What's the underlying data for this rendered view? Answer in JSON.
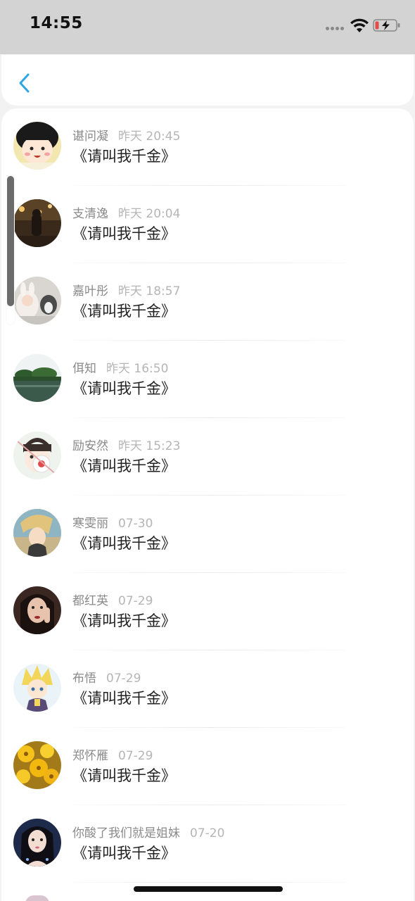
{
  "status_bar": {
    "time": "14:55",
    "icons": [
      "cellular-dots-icon",
      "wifi-icon",
      "battery-charging-icon"
    ]
  },
  "nav": {
    "back_icon": "chevron-left-icon",
    "accent_color": "#2ea6e6"
  },
  "colors": {
    "status_bar_bg": "#d3d3d3",
    "page_bg": "#f2f2f2",
    "card_bg": "#ffffff",
    "name_text": "#8a8a8a",
    "time_text": "#b5b5b5",
    "title_text": "#222222",
    "battery_low": "#e34a4a"
  },
  "list": {
    "items": [
      {
        "name": "谌问凝",
        "time": "昨天 20:45",
        "title": "《请叫我千金》",
        "avatar": "cartoon-girl-avatar"
      },
      {
        "name": "支清逸",
        "time": "昨天 20:04",
        "title": "《请叫我千金》",
        "avatar": "night-street-avatar"
      },
      {
        "name": "嘉叶彤",
        "time": "昨天 18:57",
        "title": "《请叫我千金》",
        "avatar": "baby-and-dog-avatar"
      },
      {
        "name": "佴知",
        "time": "昨天 16:50",
        "title": "《请叫我千金》",
        "avatar": "lake-landscape-avatar"
      },
      {
        "name": "励安然",
        "time": "昨天 15:23",
        "title": "《请叫我千金》",
        "avatar": "anime-boy-mask-avatar"
      },
      {
        "name": "寒雯丽",
        "time": "07-30",
        "title": "《请叫我千金》",
        "avatar": "anime-blonde-avatar"
      },
      {
        "name": "都红英",
        "time": "07-29",
        "title": "《请叫我千金》",
        "avatar": "woman-portrait-avatar"
      },
      {
        "name": "布悟",
        "time": "07-29",
        "title": "《请叫我千金》",
        "avatar": "anime-yellow-hair-avatar"
      },
      {
        "name": "郑怀雁",
        "time": "07-29",
        "title": "《请叫我千金》",
        "avatar": "yellow-flowers-avatar"
      },
      {
        "name": "你酸了我们就是姐妹",
        "time": "07-20",
        "title": "《请叫我千金》",
        "avatar": "girl-portrait-avatar"
      }
    ]
  }
}
